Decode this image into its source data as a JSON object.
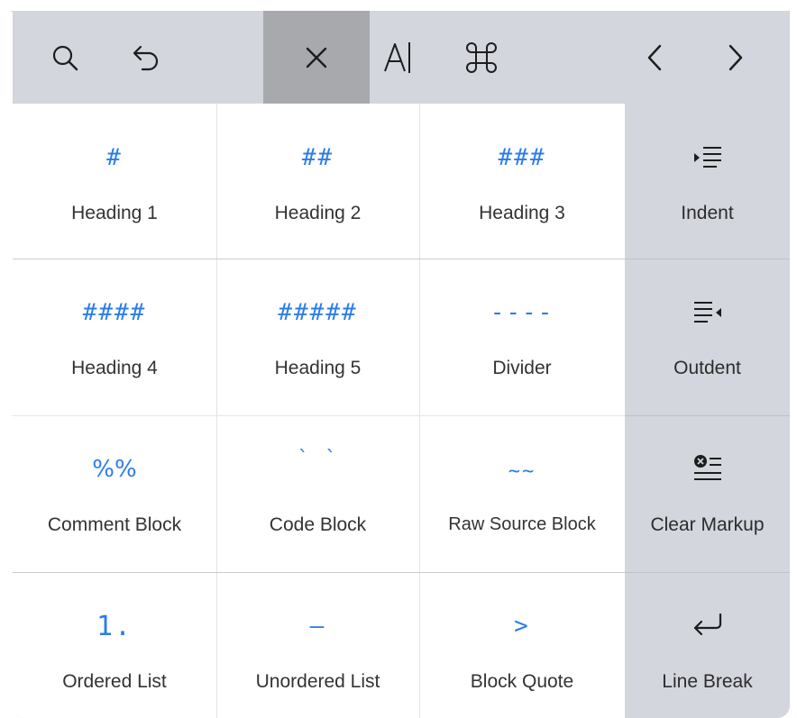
{
  "toolbar": {
    "buttons": [
      {
        "icon": "search-icon",
        "active": false
      },
      {
        "icon": "undo-icon",
        "active": false
      },
      {
        "icon": "close-icon",
        "active": true
      },
      {
        "icon": "text-cursor-icon",
        "active": false
      },
      {
        "icon": "command-icon",
        "active": false
      },
      {
        "icon": "chevron-left-icon",
        "active": false
      },
      {
        "icon": "chevron-right-icon",
        "active": false
      }
    ]
  },
  "grid": {
    "rows": [
      [
        {
          "symbol": "#",
          "label": "Heading 1"
        },
        {
          "symbol": "##",
          "label": "Heading 2"
        },
        {
          "symbol": "###",
          "label": "Heading 3"
        },
        {
          "icon": "indent-icon",
          "label": "Indent"
        }
      ],
      [
        {
          "symbol": "####",
          "label": "Heading 4"
        },
        {
          "symbol": "#####",
          "label": "Heading 5"
        },
        {
          "symbol": "----",
          "label": "Divider"
        },
        {
          "icon": "outdent-icon",
          "label": "Outdent"
        }
      ],
      [
        {
          "symbol": "%%",
          "label": "Comment Block"
        },
        {
          "symbol": "` `",
          "label": "Code Block"
        },
        {
          "symbol": "~~",
          "label": "Raw Source Block"
        },
        {
          "icon": "clear-markup-icon",
          "label": "Clear Markup"
        }
      ],
      [
        {
          "symbol": "1.",
          "label": "Ordered List"
        },
        {
          "symbol": "–",
          "label": "Unordered List"
        },
        {
          "symbol": ">",
          "label": "Block Quote"
        },
        {
          "icon": "return-arrow-icon",
          "label": "Line Break"
        }
      ]
    ]
  },
  "colors": {
    "accent": "#2b7de9",
    "panel_gray": "#d3d6dc",
    "active_key": "#a8a9ad",
    "label_text": "#333333"
  }
}
